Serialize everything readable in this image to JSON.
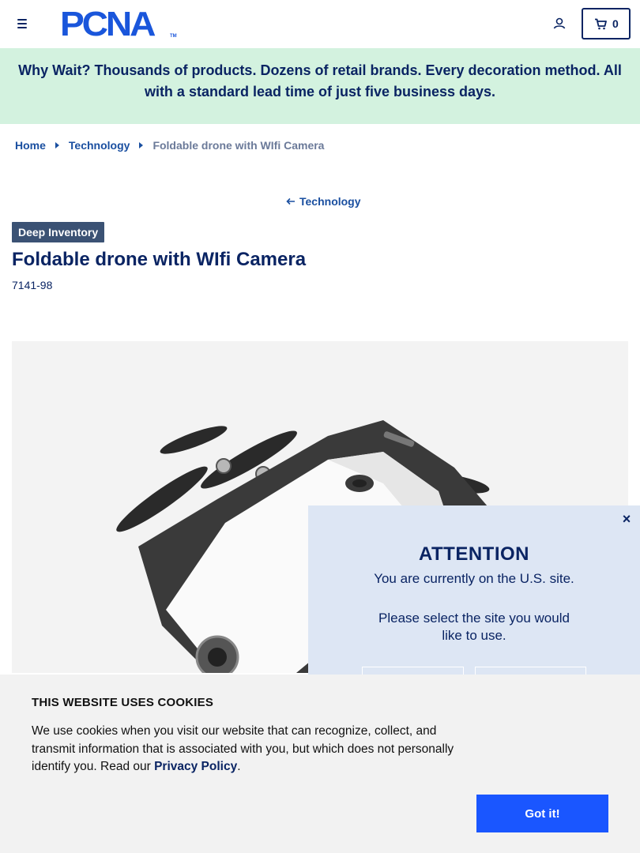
{
  "header": {
    "logo_text": "PCNA",
    "logo_tm": "TM",
    "cart_count": "0"
  },
  "banner": {
    "text": "Why Wait? Thousands of products. Dozens of retail brands. Every decoration method. All with a standard lead time of just five business days."
  },
  "breadcrumb": {
    "items": [
      "Home",
      "Technology"
    ],
    "current": "Foldable drone with WIfi Camera"
  },
  "back_link": "Technology",
  "product": {
    "badge": "Deep Inventory",
    "title": "Foldable drone with WIfi Camera",
    "sku": "7141-98"
  },
  "region_modal": {
    "close": "×",
    "title": "ATTENTION",
    "message": "You are currently on the U.S. site.",
    "prompt": "Please select the site you would like to use."
  },
  "cookie": {
    "title": "THIS WEBSITE USES COOKIES",
    "body": "We use cookies when you visit our website that can recognize, collect, and transmit information that is associated with you, but which does not personally identify you. Read our ",
    "link": "Privacy Policy",
    "after": ".",
    "button": "Got it!"
  },
  "colors": {
    "navy": "#0a2463",
    "brand_blue": "#1a56db",
    "banner_green": "#d3f2df",
    "badge_bg": "#3b5274",
    "cookie_button": "#1a56ff"
  },
  "icons": [
    "menu-icon",
    "user-icon",
    "cart-icon",
    "arrow-left-icon",
    "caret-right-icon",
    "close-icon"
  ]
}
